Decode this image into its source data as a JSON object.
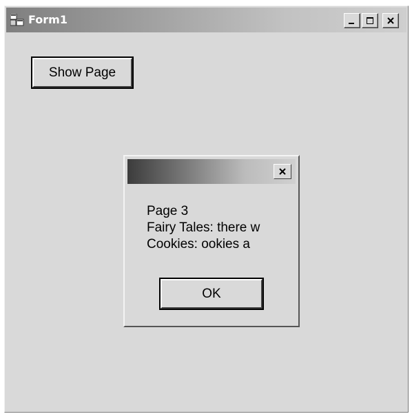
{
  "window": {
    "title": "Form1",
    "icon": "form-window-icon",
    "controls": [
      "minimize-icon",
      "maximize-icon",
      "close-icon"
    ]
  },
  "main": {
    "show_page_label": "Show Page"
  },
  "dialog": {
    "title": "",
    "lines": [
      "Page 3",
      "Fairy Tales:  there w",
      "Cookies: ookies a"
    ],
    "ok_label": "OK"
  }
}
